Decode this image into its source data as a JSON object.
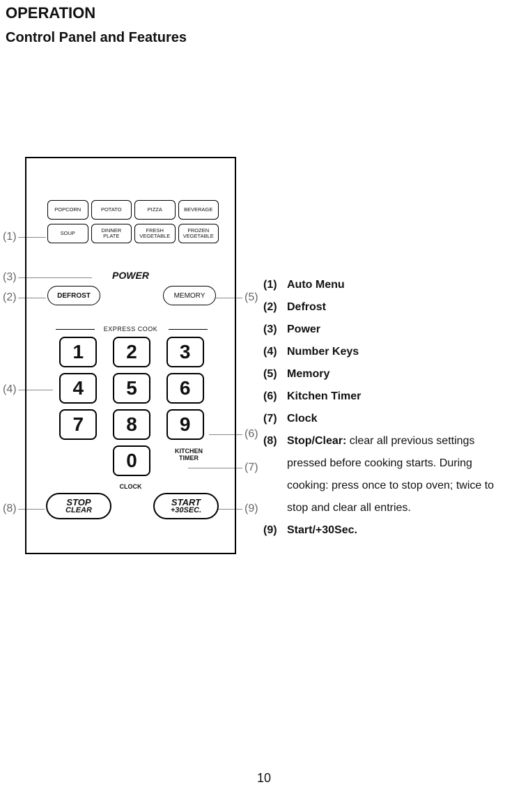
{
  "title": "OPERATION",
  "subtitle": "Control Panel and Features",
  "page_number": "10",
  "callouts": {
    "c1": "(1)",
    "c2": "(2)",
    "c3": "(3)",
    "c4": "(4)",
    "c5": "(5)",
    "c6": "(6)",
    "c7": "(7)",
    "c8": "(8)",
    "c9": "(9)"
  },
  "panel": {
    "automenu": {
      "row1": [
        "POPCORN",
        "POTATO",
        "PIZZA",
        "BEVERAGE"
      ],
      "row2": [
        "SOUP",
        "DINNER\nPLATE",
        "FRESH\nVEGETABLE",
        "FROZEN\nVEGETABLE"
      ]
    },
    "power_label": "POWER",
    "defrost_label": "DEFROST",
    "memory_label": "MEMORY",
    "express_label": "EXPRESS COOK",
    "keys": [
      "1",
      "2",
      "3",
      "4",
      "5",
      "6",
      "7",
      "8",
      "9",
      "0"
    ],
    "kitchen_timer": "KITCHEN\nTIMER",
    "clock": "CLOCK",
    "stop_top": "STOP",
    "stop_bot": "CLEAR",
    "start_top": "START",
    "start_bot": "+30SEC."
  },
  "legend": {
    "items": [
      {
        "num": "(1)",
        "bold": "Auto Menu",
        "extra": ""
      },
      {
        "num": "(2)",
        "bold": "Defrost",
        "extra": ""
      },
      {
        "num": "(3)",
        "bold": "Power",
        "extra": ""
      },
      {
        "num": "(4)",
        "bold": "Number Keys",
        "extra": ""
      },
      {
        "num": "(5)",
        "bold": "Memory",
        "extra": ""
      },
      {
        "num": "(6)",
        "bold": "Kitchen Timer",
        "extra": ""
      },
      {
        "num": "(7)",
        "bold": "Clock",
        "extra": ""
      },
      {
        "num": "(8)",
        "bold": "Stop/Clear:",
        "extra": " clear all previous  settings",
        "cont": "pressed before cooking starts. During cooking: press once to stop oven; twice to stop and clear all entries."
      },
      {
        "num": "(9)",
        "bold": "Start/+30Sec.",
        "extra": ""
      }
    ]
  }
}
